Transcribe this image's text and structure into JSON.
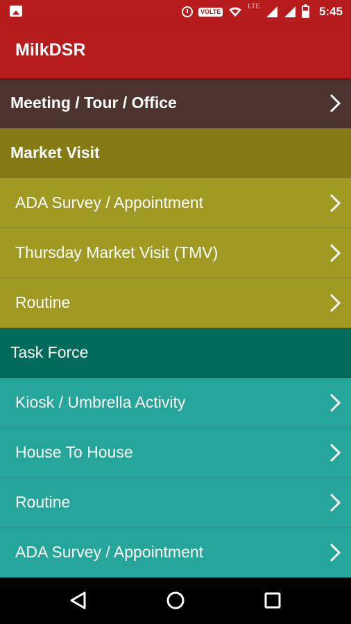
{
  "status_bar": {
    "time": "5:45",
    "volte": "VOLTE",
    "network_type": "LTE",
    "icons": [
      "image-icon",
      "alarm-icon",
      "volte-icon",
      "wifi-icon",
      "signal-icon",
      "signal-icon",
      "battery-icon"
    ]
  },
  "app_bar": {
    "title": "MilkDSR"
  },
  "menu": {
    "meeting": {
      "label": "Meeting / Tour / Office",
      "color": "#4e3430"
    },
    "market_visit": {
      "label": "Market Visit",
      "header_color": "#857b15",
      "item_color": "#a09a23",
      "items": [
        {
          "label": "ADA Survey / Appointment"
        },
        {
          "label": "Thursday Market Visit (TMV)"
        },
        {
          "label": "Routine"
        }
      ]
    },
    "task_force": {
      "label": "Task Force",
      "header_color": "#006b5a",
      "item_color": "#26a69a",
      "items": [
        {
          "label": "Kiosk / Umbrella Activity"
        },
        {
          "label": "House To House"
        },
        {
          "label": "Routine"
        },
        {
          "label": "ADA Survey / Appointment"
        }
      ]
    }
  },
  "colors": {
    "primary": "#b71c1c",
    "nav_bar": "#000000"
  },
  "nav_bar": {
    "buttons": [
      "back-icon",
      "home-icon",
      "recents-icon"
    ]
  }
}
